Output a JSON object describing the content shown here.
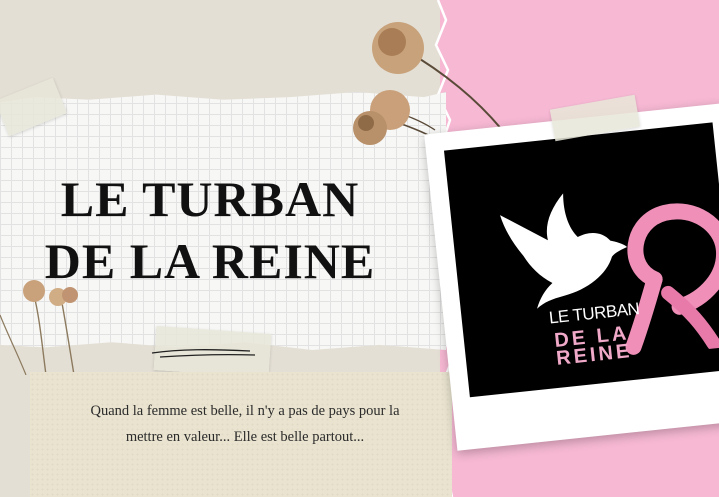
{
  "title_line1": "LE TURBAN",
  "title_line2": "DE LA REINE",
  "quote_line1": "Quand la femme est belle, il n'y a pas de pays pour la",
  "quote_line2": "mettre en valeur... Elle est belle partout...",
  "logo": {
    "turban": "LE TURBAN",
    "de_la": "DE LA",
    "reine": "REINE"
  },
  "colors": {
    "background": "#e4dfd5",
    "pink": "#f6b8d3",
    "ribbon": "#f08fb8",
    "photo_bg": "#000000"
  },
  "icons": [
    "dove-icon",
    "pink-ribbon-icon",
    "dried-flower-icon"
  ]
}
